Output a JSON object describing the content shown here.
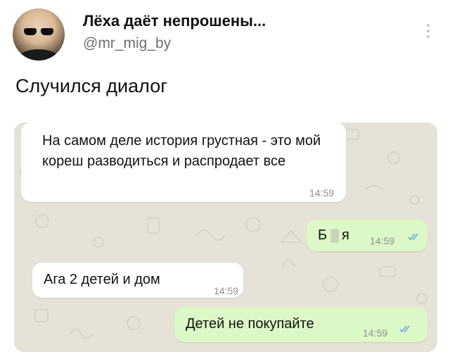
{
  "post": {
    "display_name": "Лёха даёт непрошены...",
    "handle": "@mr_mig_by",
    "text": "Случился диалог",
    "more_icon": "vertical-ellipsis-icon"
  },
  "chat": {
    "background_color": "#e7e2d8",
    "incoming_color": "#ffffff",
    "outgoing_color": "#dcf8c6",
    "tick_color": "#5fa8e6",
    "messages": [
      {
        "direction": "incoming",
        "text": "На самом деле история грустная - это мой кореш разводиться и распродает все",
        "time": "14:59"
      },
      {
        "direction": "outgoing",
        "text_part1": "Б",
        "text_part2": "я",
        "time": "14:59",
        "status_icon": "double-check-icon"
      },
      {
        "direction": "incoming",
        "text": "Ага 2 детей и дом",
        "time": "14:59"
      },
      {
        "direction": "outgoing",
        "text": "Детей не покупайте",
        "time": "14:59",
        "status_icon": "double-check-icon"
      }
    ]
  }
}
